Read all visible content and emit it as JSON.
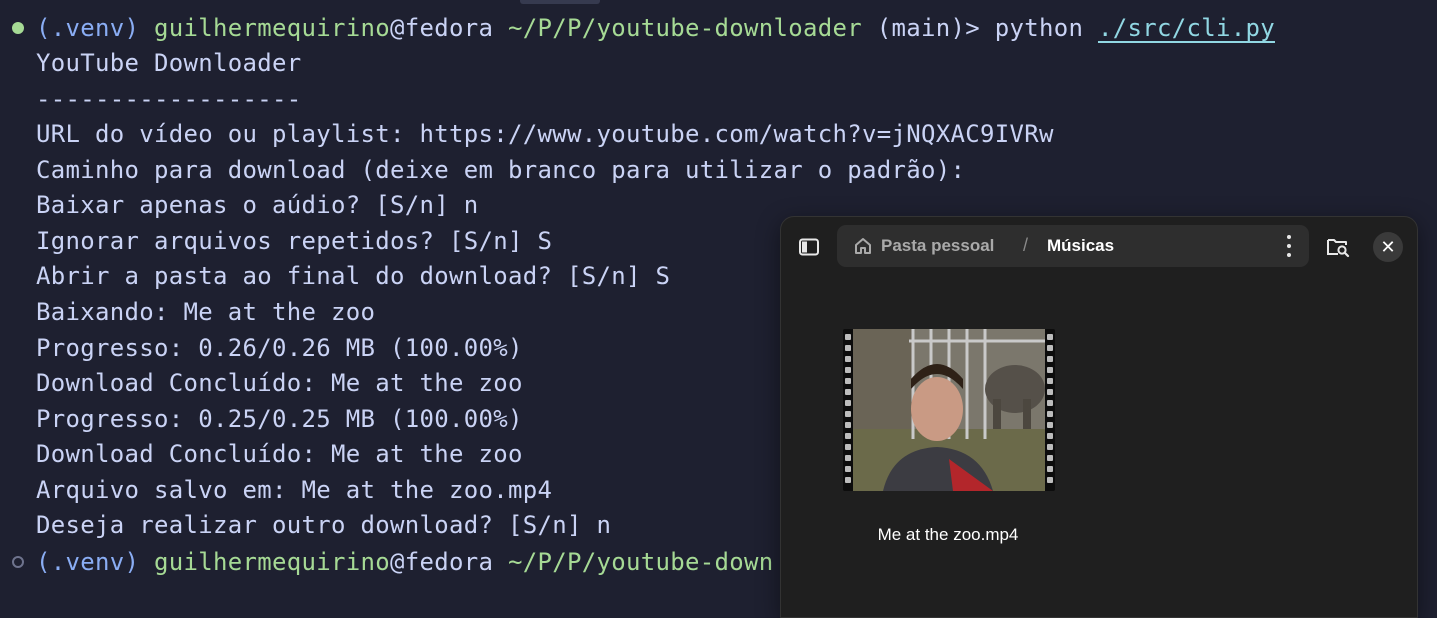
{
  "terminal": {
    "prompt1": {
      "venv": "(.venv)",
      "user": "guilhermequirino",
      "host": "@fedora",
      "path": "~/P/P/youtube-downloader",
      "branch": "(main)>",
      "command": "python",
      "arg": "./src/cli.py"
    },
    "lines": [
      "YouTube Downloader",
      "------------------",
      "URL do vídeo ou playlist: https://www.youtube.com/watch?v=jNQXAC9IVRw",
      "Caminho para download (deixe em branco para utilizar o padrão):",
      "Baixar apenas o aúdio? [S/n] n",
      "Ignorar arquivos repetidos? [S/n] S",
      "Abrir a pasta ao final do download? [S/n] S",
      "Baixando: Me at the zoo",
      "Progresso: 0.26/0.26 MB (100.00%)",
      "Download Concluído: Me at the zoo",
      "Progresso: 0.25/0.25 MB (100.00%)",
      "Download Concluído: Me at the zoo",
      "Arquivo salvo em: Me at the zoo.mp4",
      "Deseja realizar outro download? [S/n] n"
    ],
    "prompt2": {
      "venv": "(.venv)",
      "user": "guilhermequirino",
      "host": "@fedora",
      "path": "~/P/P/youtube-down"
    },
    "colors": {
      "background": "#1e2030",
      "text": "#cad3f5",
      "venv": "#8aadf4",
      "user": "#a6da95",
      "link": "#91d7e3"
    }
  },
  "file_manager": {
    "breadcrumb": {
      "home": "Pasta pessoal",
      "separator": "/",
      "current": "Músicas"
    },
    "icons": {
      "sidebar": "sidebar-toggle-icon",
      "home": "home-icon",
      "menu": "kebab-menu-icon",
      "search": "folder-search-icon",
      "close": "close-icon"
    },
    "close_glyph": "✕",
    "files": [
      {
        "name": "Me at the zoo.mp4",
        "kind": "video"
      }
    ],
    "colors": {
      "window": "#1f1f1f",
      "pathbar": "#2e2e2e"
    }
  }
}
